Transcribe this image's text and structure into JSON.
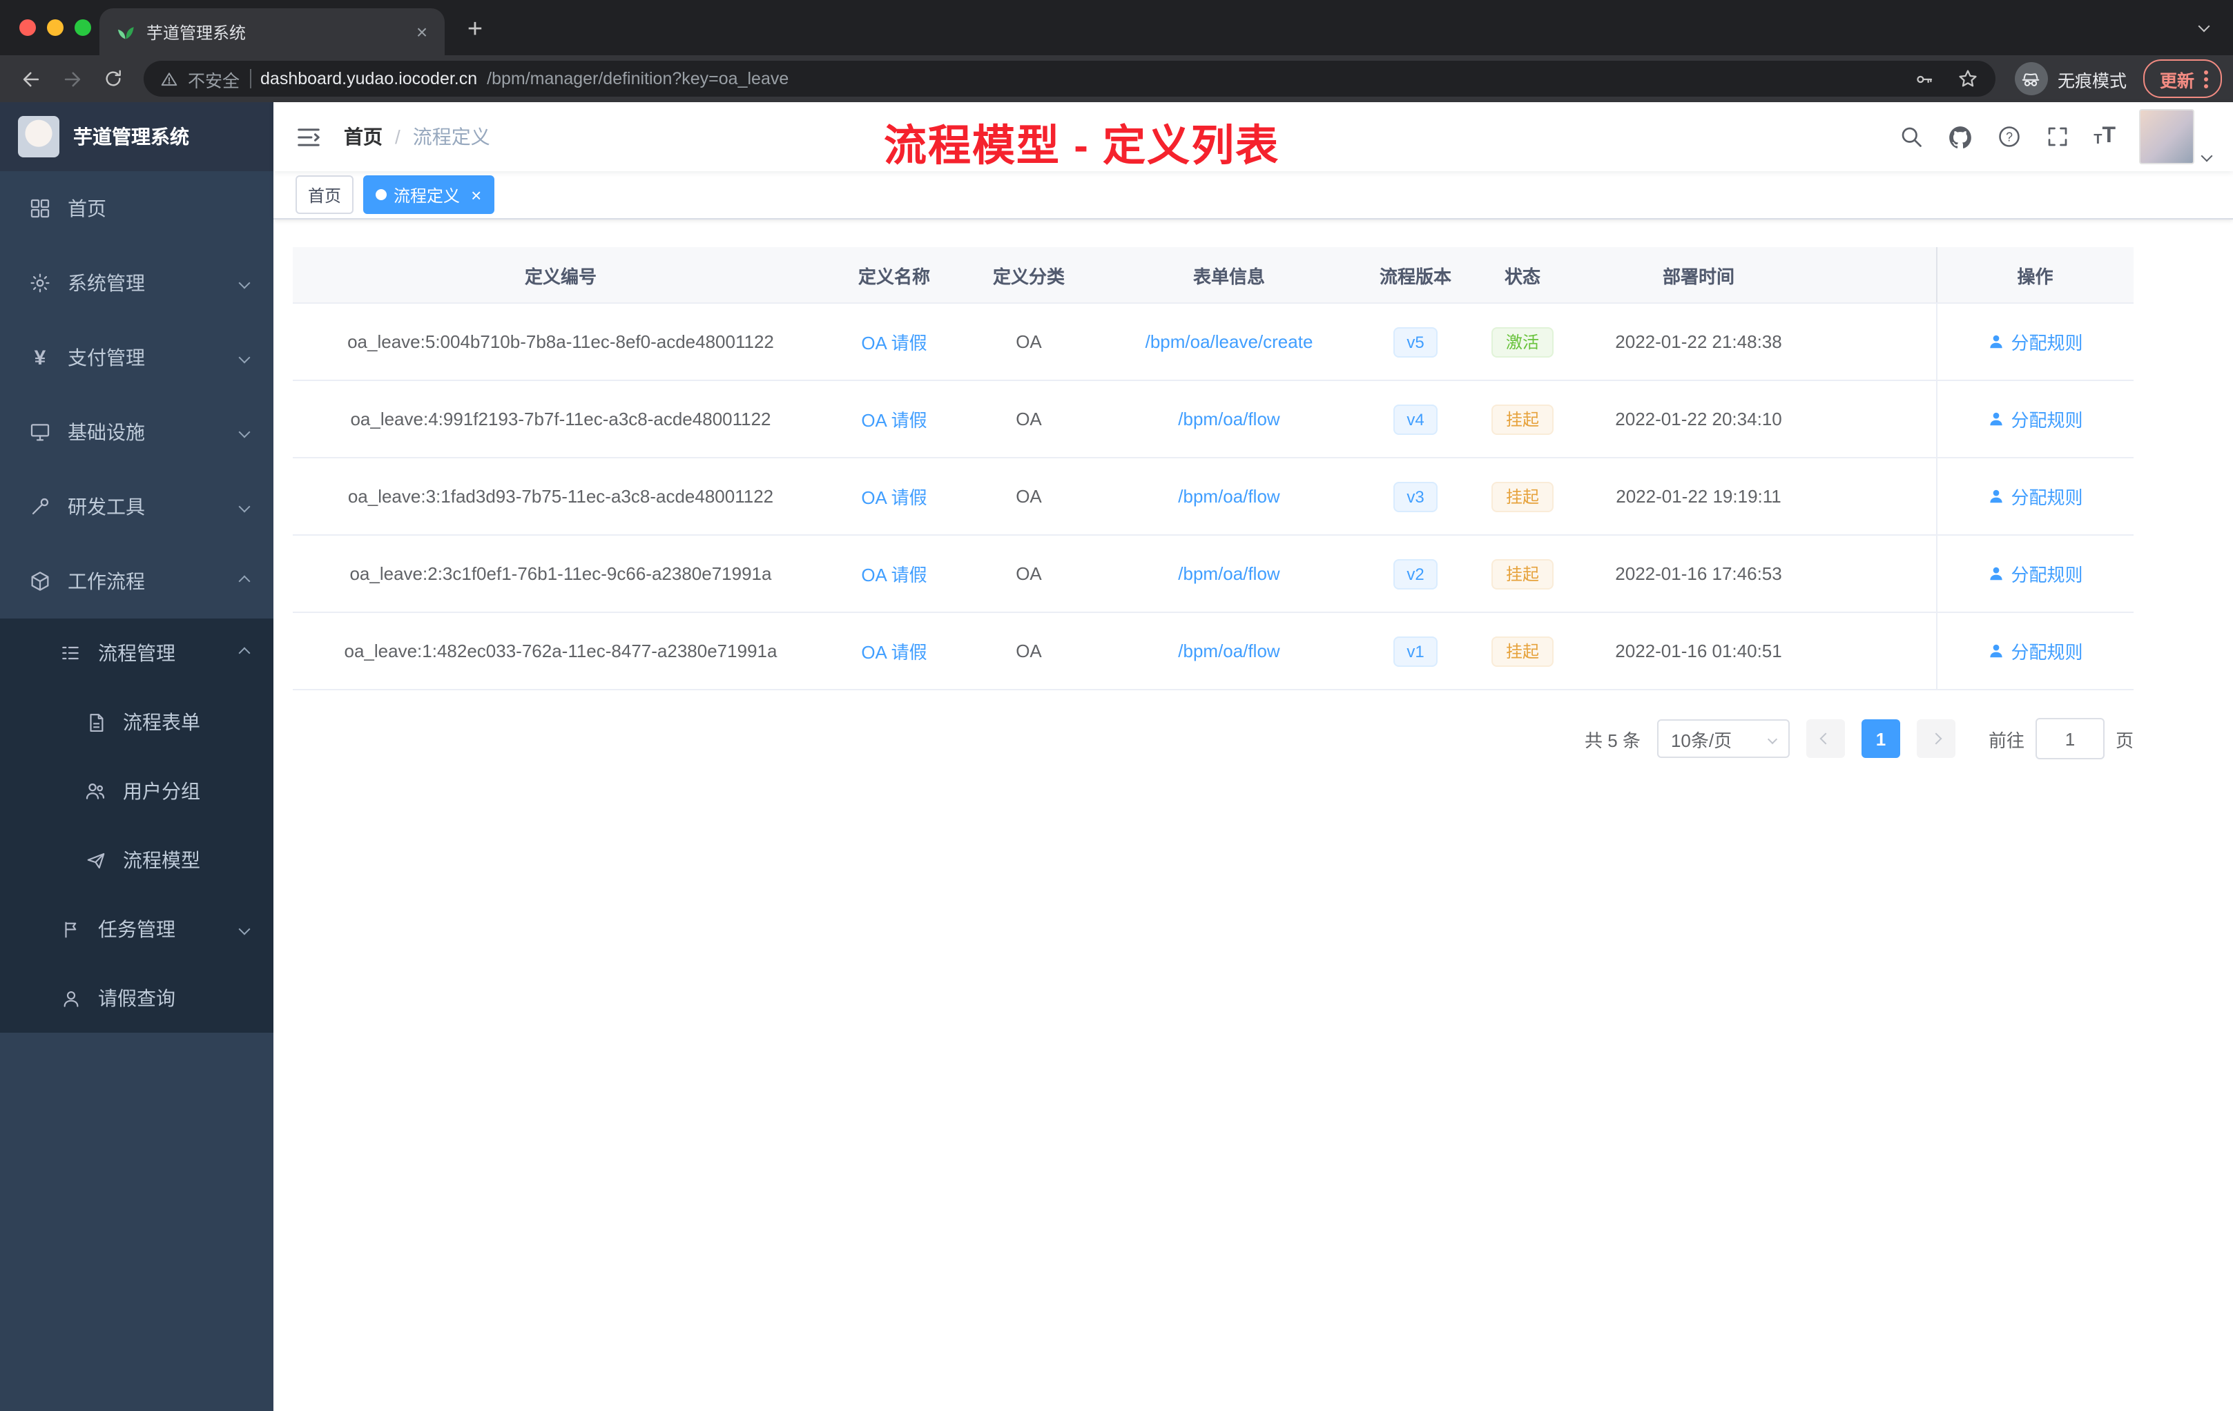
{
  "colors": {
    "accent": "#409eff",
    "annotation_red": "#f5222d",
    "status_active_green": "#67c23a",
    "status_suspend_orange": "#e6a23c",
    "sidebar_bg": "#304156",
    "sidebar_submenu_bg": "#1f2d3d"
  },
  "browser": {
    "tab_title": "芋道管理系统",
    "security_label": "不安全",
    "url_host": "dashboard.yudao.iocoder.cn",
    "url_path": "/bpm/manager/definition?key=oa_leave",
    "incognito_label": "无痕模式",
    "update_label": "更新"
  },
  "sidebar": {
    "logo_title": "芋道管理系统",
    "items": [
      {
        "label": "首页",
        "icon": "dashboard-icon"
      },
      {
        "label": "系统管理",
        "icon": "gear-icon"
      },
      {
        "label": "支付管理",
        "icon": "yen-icon"
      },
      {
        "label": "基础设施",
        "icon": "monitor-icon"
      },
      {
        "label": "研发工具",
        "icon": "tool-icon"
      },
      {
        "label": "工作流程",
        "icon": "workflow-icon"
      },
      {
        "label": "流程管理",
        "icon": "tree-icon"
      },
      {
        "label": "流程表单",
        "icon": "form-icon"
      },
      {
        "label": "用户分组",
        "icon": "user-group-icon"
      },
      {
        "label": "流程模型",
        "icon": "paper-plane-icon"
      },
      {
        "label": "任务管理",
        "icon": "flag-icon"
      },
      {
        "label": "请假查询",
        "icon": "person-icon"
      }
    ]
  },
  "header": {
    "breadcrumb_home": "首页",
    "breadcrumb_sep": "/",
    "breadcrumb_current": "流程定义",
    "annotation": "流程模型 - 定义列表"
  },
  "tags": {
    "home": "首页",
    "active": "流程定义"
  },
  "table": {
    "columns": [
      "定义编号",
      "定义名称",
      "定义分类",
      "表单信息",
      "流程版本",
      "状态",
      "部署时间",
      "操作"
    ],
    "rows": [
      {
        "id": "oa_leave:5:004b710b-7b8a-11ec-8ef0-acde48001122",
        "name": "OA 请假",
        "category": "OA",
        "form": "/bpm/oa/leave/create",
        "version": "v5",
        "status": "激活",
        "time": "2022-01-22 21:48:38",
        "action": "分配规则"
      },
      {
        "id": "oa_leave:4:991f2193-7b7f-11ec-a3c8-acde48001122",
        "name": "OA 请假",
        "category": "OA",
        "form": "/bpm/oa/flow",
        "version": "v4",
        "status": "挂起",
        "time": "2022-01-22 20:34:10",
        "action": "分配规则"
      },
      {
        "id": "oa_leave:3:1fad3d93-7b75-11ec-a3c8-acde48001122",
        "name": "OA 请假",
        "category": "OA",
        "form": "/bpm/oa/flow",
        "version": "v3",
        "status": "挂起",
        "time": "2022-01-22 19:19:11",
        "action": "分配规则"
      },
      {
        "id": "oa_leave:2:3c1f0ef1-76b1-11ec-9c66-a2380e71991a",
        "name": "OA 请假",
        "category": "OA",
        "form": "/bpm/oa/flow",
        "version": "v2",
        "status": "挂起",
        "time": "2022-01-16 17:46:53",
        "action": "分配规则"
      },
      {
        "id": "oa_leave:1:482ec033-762a-11ec-8477-a2380e71991a",
        "name": "OA 请假",
        "category": "OA",
        "form": "/bpm/oa/flow",
        "version": "v1",
        "status": "挂起",
        "time": "2022-01-16 01:40:51",
        "action": "分配规则"
      }
    ]
  },
  "pagination": {
    "total": "共 5 条",
    "page_size": "10条/页",
    "current_page": "1",
    "goto_label": "前往",
    "goto_value": "1",
    "page_unit": "页"
  }
}
